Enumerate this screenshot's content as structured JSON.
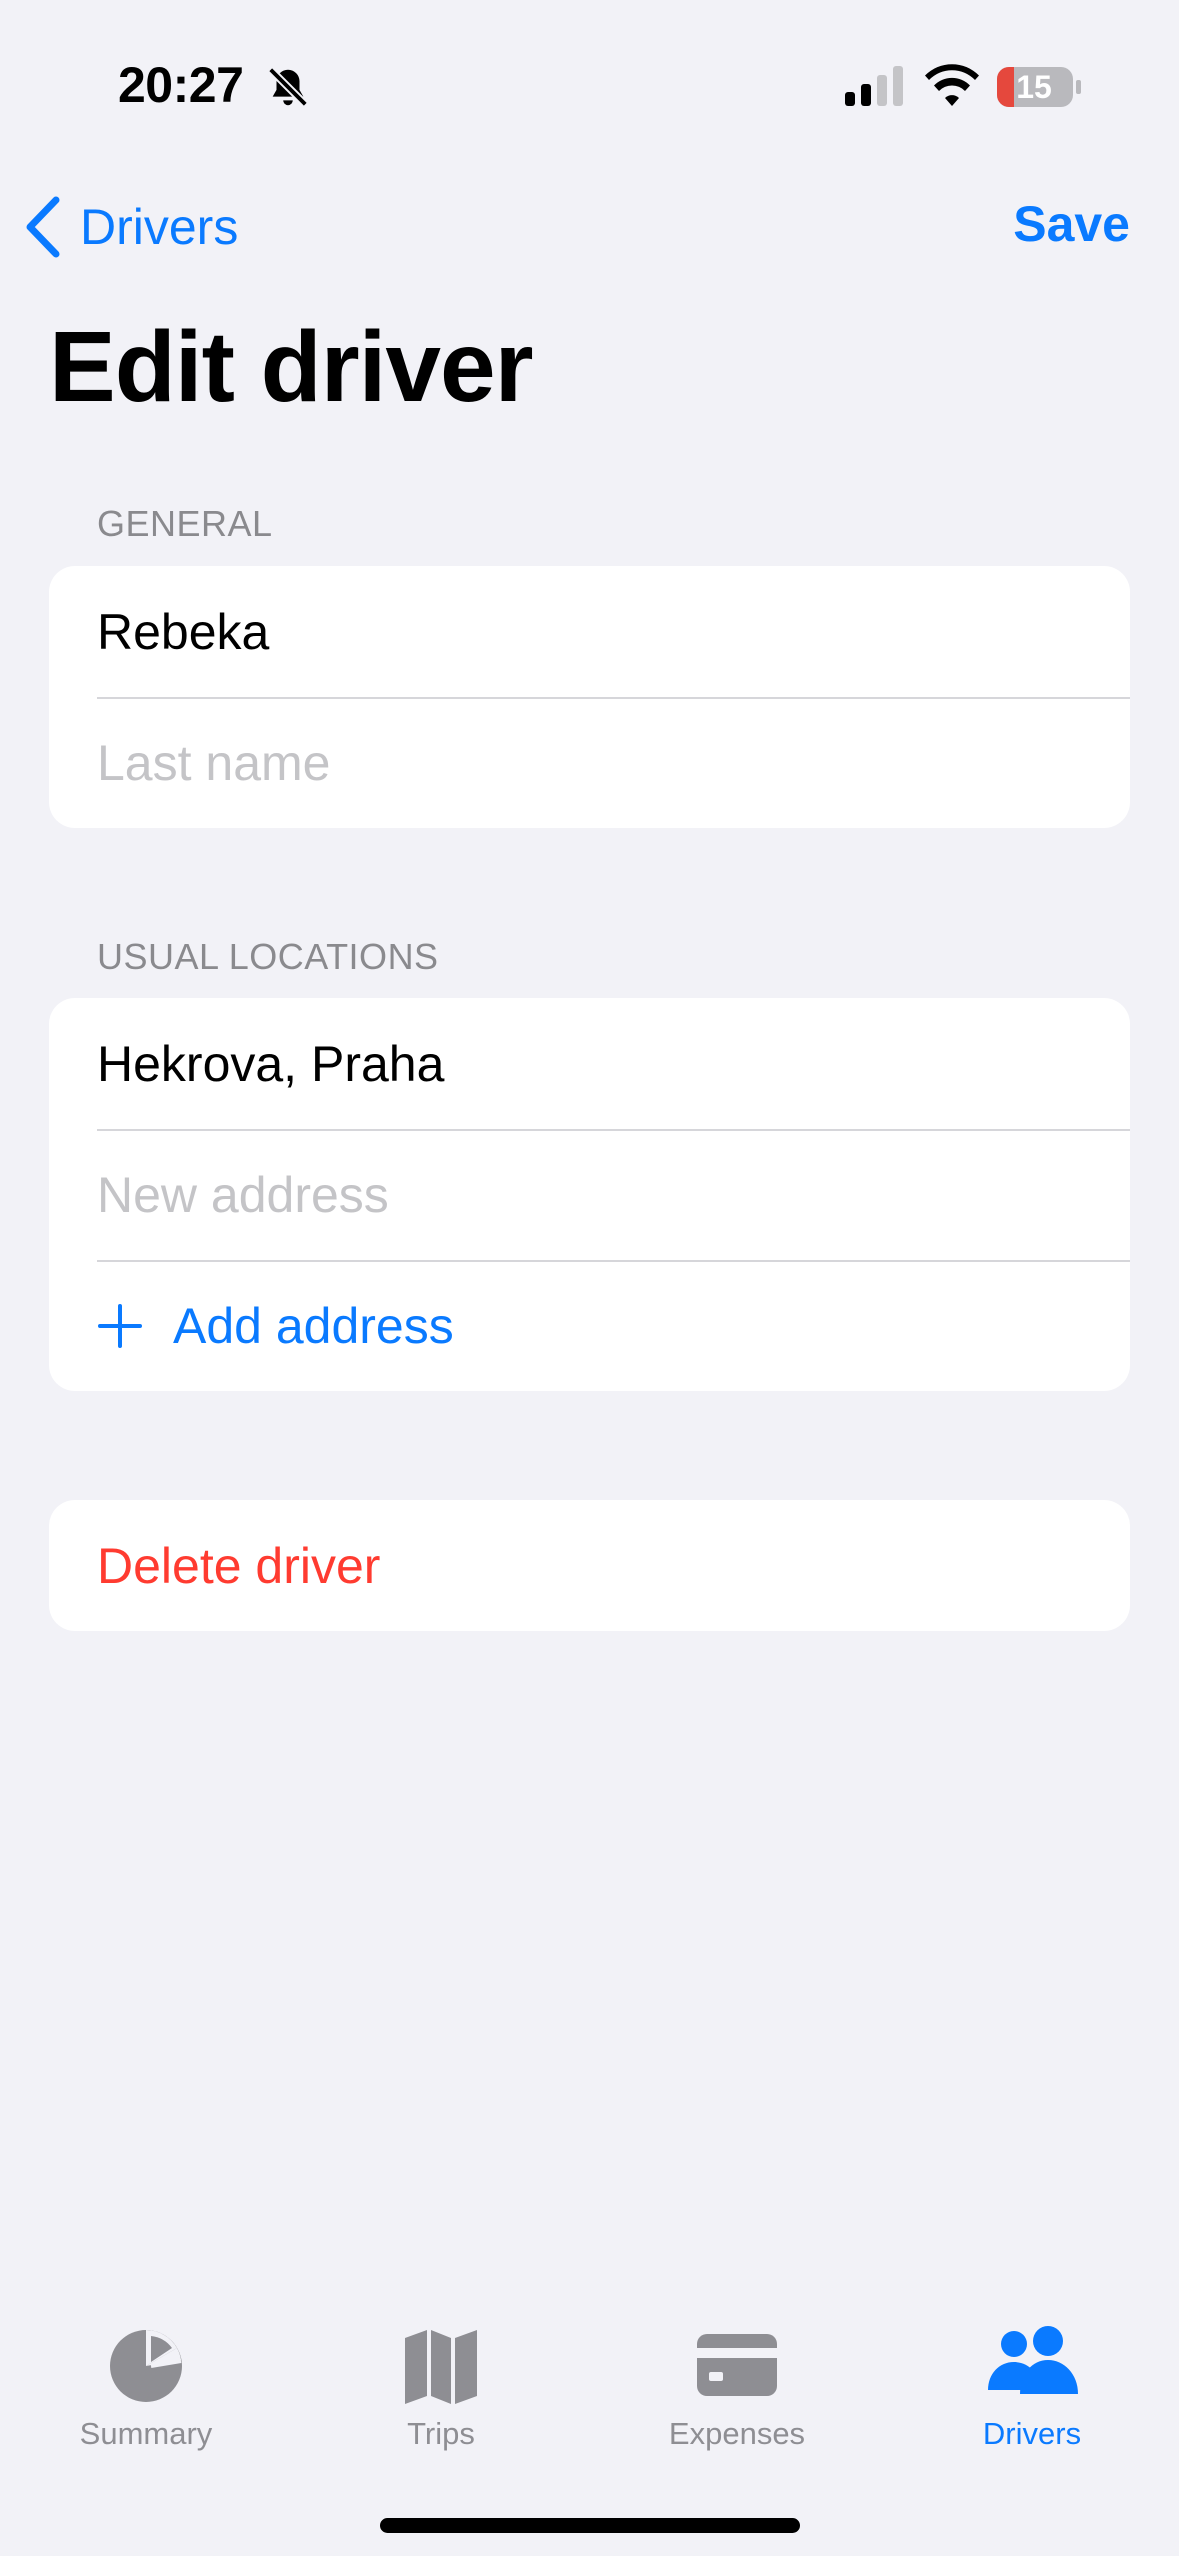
{
  "status_bar": {
    "time": "20:27",
    "battery_level": "15",
    "icons": [
      "bell-slash-icon",
      "cellular-signal-icon",
      "wifi-icon",
      "battery-icon"
    ],
    "colors": {
      "battery_low": "#e5483d"
    }
  },
  "nav": {
    "back_label": "Drivers",
    "save_label": "Save"
  },
  "title": "Edit driver",
  "general": {
    "header": "GENERAL",
    "first_name_value": "Rebeka",
    "last_name_placeholder": "Last name"
  },
  "locations": {
    "header": "USUAL LOCATIONS",
    "items": [
      "Hekrova, Praha"
    ],
    "new_address_placeholder": "New address",
    "add_label": "Add address"
  },
  "delete_label": "Delete driver",
  "tabs": [
    {
      "label": "Summary",
      "icon": "pie-chart-icon",
      "active": false
    },
    {
      "label": "Trips",
      "icon": "map-icon",
      "active": false
    },
    {
      "label": "Expenses",
      "icon": "credit-card-icon",
      "active": false
    },
    {
      "label": "Drivers",
      "icon": "people-icon",
      "active": true
    }
  ],
  "colors": {
    "accent": "#0a7aff",
    "destructive": "#ff3b30",
    "background": "#f2f2f7",
    "inactive_tab": "#8e8e93"
  }
}
